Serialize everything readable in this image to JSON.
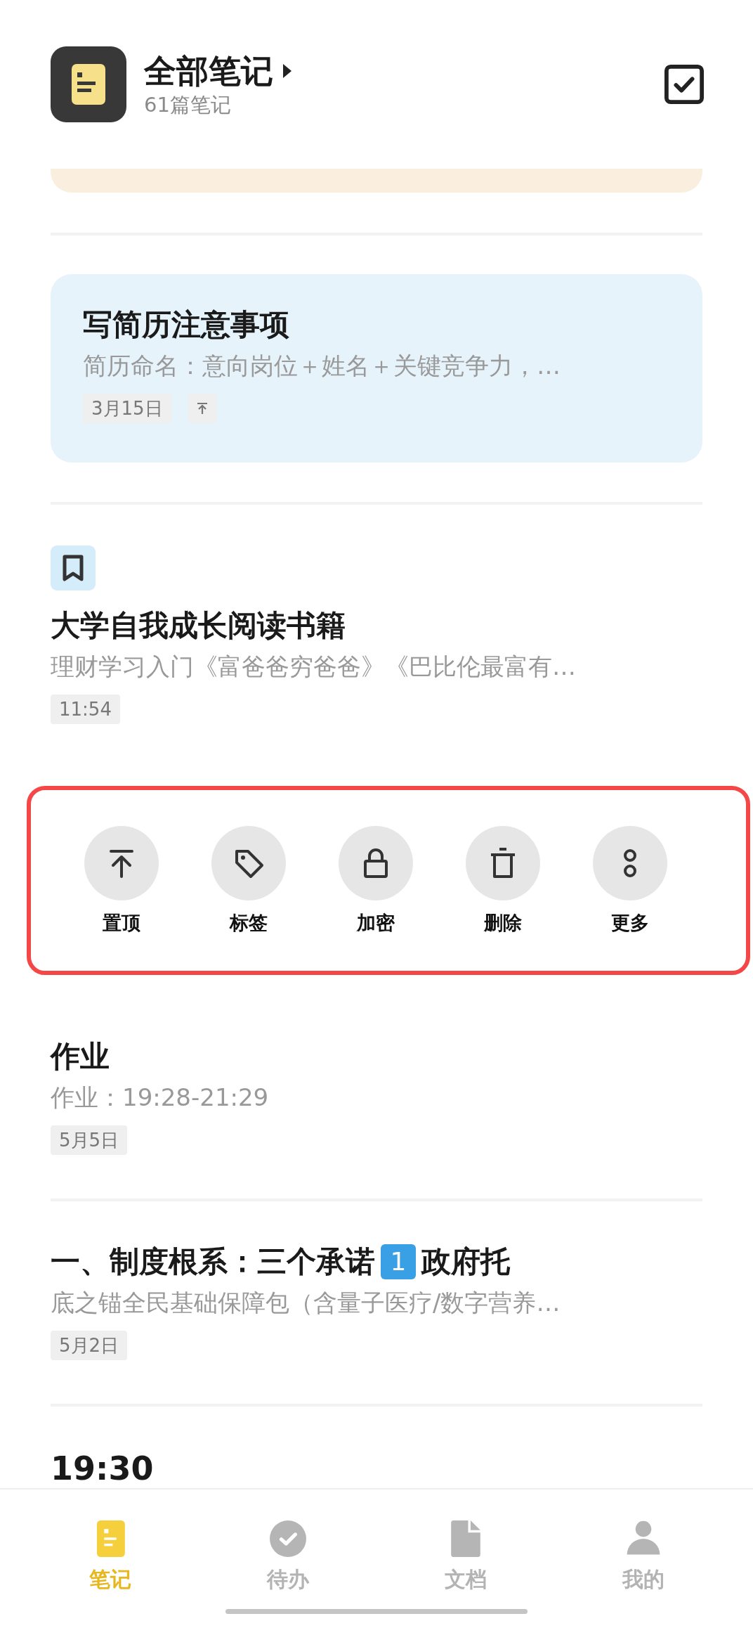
{
  "header": {
    "title": "全部笔记",
    "subtitle": "61篇笔记"
  },
  "notes": [
    {
      "kind": "card_end",
      "color": "#faeedf"
    },
    {
      "kind": "card",
      "color": "#e6f3fb",
      "title": "写简历注意事项",
      "preview": "简历命名：意向岗位＋姓名＋关键竞争力，…",
      "date": "3月15日",
      "pinned": true,
      "bookmark": false
    },
    {
      "kind": "plain",
      "title": "大学自我成长阅读书籍",
      "preview": "理财学习入门《富爸爸穷爸爸》《巴比伦最富有…",
      "date": "11:54",
      "pinned": false,
      "bookmark": true
    },
    {
      "kind": "actions",
      "actions": [
        "置顶",
        "标签",
        "加密",
        "删除",
        "更多"
      ]
    },
    {
      "kind": "plain",
      "title": "作业",
      "preview": "作业：19:28-21:29",
      "date": "5月5日",
      "pinned": false,
      "bookmark": false
    },
    {
      "kind": "plain",
      "title": "一、制度根系：三个承诺",
      "keycap": "1",
      "title_end": "政府托",
      "preview": "底之锚全民基础保障包（含量子医疗/数字营养…",
      "date": "5月2日",
      "pinned": false,
      "bookmark": false
    },
    {
      "kind": "cut",
      "title": "19:30"
    }
  ],
  "tabs": [
    {
      "label": "笔记",
      "selected": true
    },
    {
      "label": "待办",
      "selected": false
    },
    {
      "label": "文档",
      "selected": false
    },
    {
      "label": "我的",
      "selected": false
    }
  ]
}
